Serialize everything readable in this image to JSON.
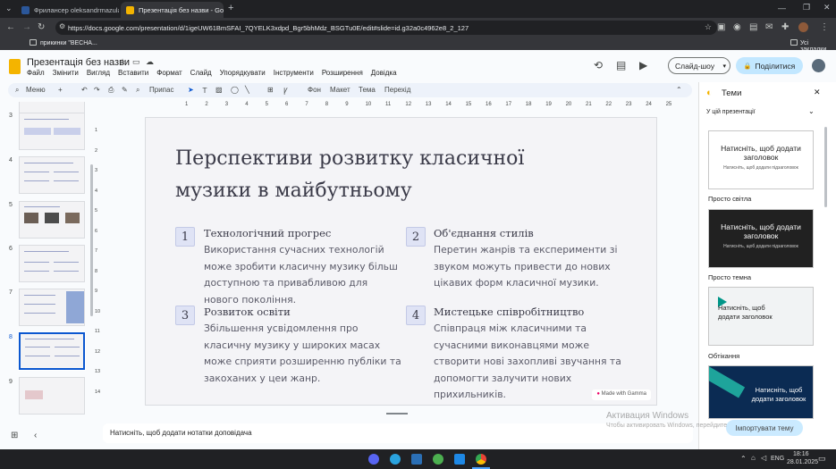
{
  "browser": {
    "tabs": [
      {
        "title": "Фрилансер oleksandrmazula1",
        "fav_color": "#2b579a"
      },
      {
        "title": "Презентація без назви - Goog",
        "fav_color": "#f4b400"
      }
    ],
    "new_tab": "+",
    "url": "https://docs.google.com/presentation/d/1igeUW61BmSFAI_7QYELK3xdpd_Bgr5bhMdz_BSGTu0E/edit#slide=id.g32a0c4962e8_2_127",
    "bookmark": "прикинки \"ВЕСНА...",
    "all_bookmarks": "Усі закладки"
  },
  "app": {
    "doc_title": "Презентація без назви",
    "menu": [
      "Файл",
      "Змінити",
      "Вигляд",
      "Вставити",
      "Формат",
      "Слайд",
      "Упорядкувати",
      "Інструменти",
      "Розширення",
      "Довідка"
    ],
    "slideshow_button": "Слайд-шоу",
    "share_button": "Поділитися",
    "toolbar": {
      "menu_search": "Меню",
      "zoom": "Припас",
      "background": "Фон",
      "layout": "Макет",
      "theme": "Тема",
      "transition": "Перехід"
    }
  },
  "filmstrip": {
    "numbers": [
      "3",
      "4",
      "5",
      "6",
      "7",
      "8",
      "9"
    ],
    "selected": "8"
  },
  "slide": {
    "title": "Перспективи розвитку класичної музики в майбутньому",
    "points": [
      {
        "num": "1",
        "title": "Технологічний прогрес",
        "body": "Використання сучасних технологій може зробити класичну музику більш доступною та привабливою для нового покоління."
      },
      {
        "num": "2",
        "title": "Об'єднання стилів",
        "body": "Перетин жанрів та експерименти зі звуком можуть привести до нових цікавих форм класичної музики."
      },
      {
        "num": "3",
        "title": "Розвиток освіти",
        "body": "Збільшення усвідомлення про класичну музику у широких масах може сприяти розширенню публіки та закоханих у цеи жанр."
      },
      {
        "num": "4",
        "title": "Мистецьке співробітництво",
        "body": "Співпраця між класичними та сучасними виконавцями може створити нові захопливі звучання та допомогти залучити нових прихильників."
      }
    ],
    "watermark": "Made with Gamma"
  },
  "ruler": {
    "top": [
      "1",
      "2",
      "3",
      "4",
      "5",
      "6",
      "7",
      "8",
      "9",
      "10",
      "11",
      "12",
      "13",
      "14",
      "15",
      "16",
      "17",
      "18",
      "19",
      "20",
      "21",
      "22",
      "23",
      "24",
      "25"
    ],
    "left": [
      "1",
      "2",
      "3",
      "4",
      "5",
      "6",
      "7",
      "8",
      "9",
      "10",
      "11",
      "12",
      "13",
      "14"
    ]
  },
  "themes": {
    "title": "Теми",
    "section": "У цій презентації",
    "card_title": "Натисніть, щоб додати заголовок",
    "card_subtitle": "Натисніть, щоб додати підзаголовок",
    "names": [
      "Просто світла",
      "Просто темна",
      "Обтікання"
    ],
    "import_button": "Імпортувати тему"
  },
  "notes": {
    "placeholder": "Натисніть, щоб додати нотатки доповідача"
  },
  "activation": {
    "line1": "Активация Windows",
    "line2": "Чтобы активировать Windows, перейдите в раздел «Параметры»."
  },
  "taskbar": {
    "lang": "ENG",
    "time": "18:16",
    "date": "28.01.2025"
  }
}
